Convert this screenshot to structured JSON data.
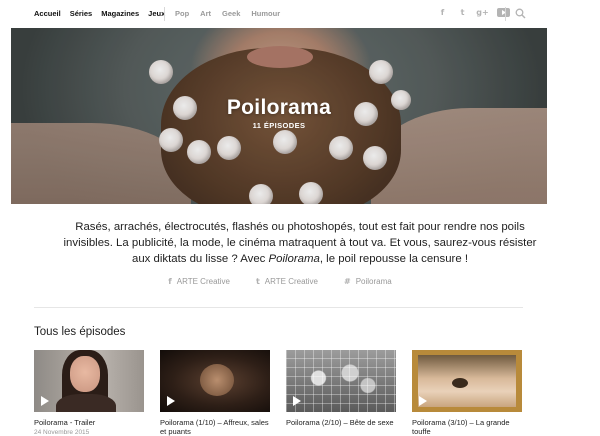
{
  "nav": {
    "primary": [
      "Accueil",
      "Séries",
      "Magazines",
      "Jeux"
    ],
    "secondary": [
      "Pop",
      "Art",
      "Geek",
      "Humour"
    ],
    "social_icons": [
      "facebook-icon",
      "twitter-icon",
      "google-plus-icon",
      "youtube-icon"
    ],
    "social_glyphs": {
      "facebook": "f",
      "twitter": "t",
      "google": "g+"
    },
    "search_icon": "search-icon"
  },
  "hero": {
    "title": "Poilorama",
    "count": "11 ÉPISODES"
  },
  "description": {
    "before": "Rasés, arrachés, électrocutés, flashés ou photoshopés, tout est fait pour rendre nos poils invisibles. La publicité, la mode, le cinéma matraquent à tout va. Et vous, saurez-vous résister aux diktats du lisse ? Avec ",
    "emphasis": "Poilorama",
    "after": ", le poil repousse la censure !"
  },
  "share": [
    {
      "icon": "facebook-icon",
      "glyph": "f",
      "label": "ARTE Creative"
    },
    {
      "icon": "twitter-icon",
      "glyph": "t",
      "label": "ARTE Creative"
    },
    {
      "icon": "hashtag-icon",
      "glyph": "#",
      "label": "Poilorama"
    }
  ],
  "section_title": "Tous les épisodes",
  "episodes": [
    {
      "title": "Poilorama - Trailer",
      "date": "24 Novembre 2015"
    },
    {
      "title": "Poilorama (1/10) – Affreux, sales et puants",
      "date": ""
    },
    {
      "title": "Poilorama (2/10) – Bête de sexe",
      "date": ""
    },
    {
      "title": "Poilorama (3/10) – La grande touffe",
      "date": ""
    }
  ],
  "colors": {
    "nav_secondary": "#9a9a9a",
    "muted": "#999999",
    "text": "#222222"
  }
}
